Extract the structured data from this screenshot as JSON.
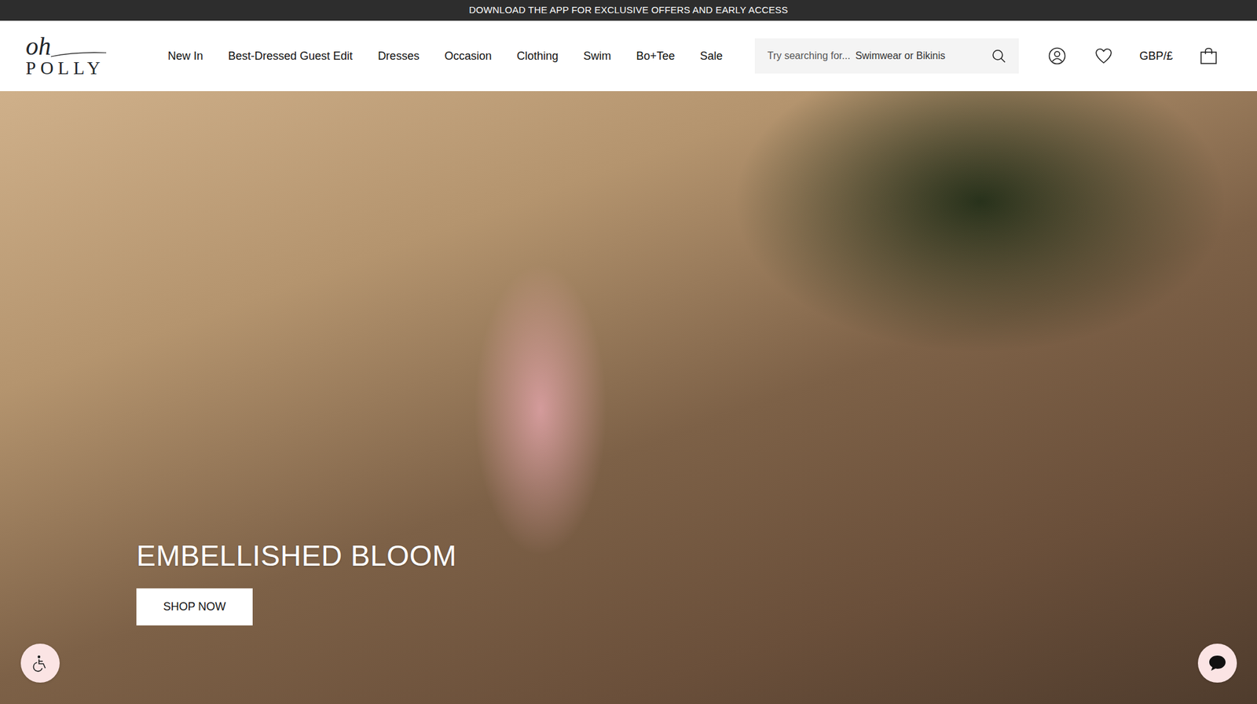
{
  "banner": {
    "text": "DOWNLOAD THE APP FOR EXCLUSIVE OFFERS AND EARLY ACCESS"
  },
  "logo": {
    "script": "oh",
    "wordmark": "POLLY"
  },
  "nav": {
    "items": [
      {
        "label": "New In"
      },
      {
        "label": "Best-Dressed Guest Edit"
      },
      {
        "label": "Dresses"
      },
      {
        "label": "Occasion"
      },
      {
        "label": "Clothing"
      },
      {
        "label": "Swim"
      },
      {
        "label": "Bo+Tee"
      },
      {
        "label": "Sale"
      }
    ]
  },
  "search": {
    "placeholder": "Try searching for...",
    "suggestion": "Swimwear or Bikinis"
  },
  "currency": "GBP/£",
  "hero": {
    "title": "EMBELLISHED BLOOM",
    "button": "SHOP NOW"
  }
}
